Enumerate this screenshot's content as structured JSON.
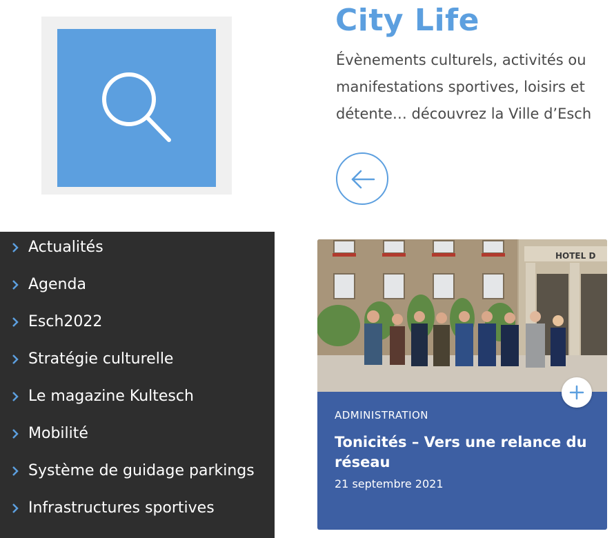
{
  "search_tile": {
    "icon": "search-icon",
    "color": "#5c9fdf"
  },
  "city_life": {
    "title": "City Life",
    "description": "Évènements culturels, activités ou manifestations sportives, loisirs et détente… découvrez la Ville d’Esch",
    "back_icon": "arrow-left-icon"
  },
  "menu": {
    "items": [
      {
        "label": "Actualités"
      },
      {
        "label": "Agenda"
      },
      {
        "label": "Esch2022"
      },
      {
        "label": "Stratégie culturelle"
      },
      {
        "label": "Le magazine Kultesch"
      },
      {
        "label": "Mobilité"
      },
      {
        "label": "Système de guidage parkings"
      },
      {
        "label": "Infrastructures sportives"
      }
    ]
  },
  "news_card": {
    "photo_sign": "HOTEL D",
    "category": "ADMINISTRATION",
    "title": "Tonicités – Vers une relance du réseau",
    "date": "21 septembre 2021",
    "plus_icon": "plus-icon"
  },
  "colors": {
    "accent": "#5c9fdf",
    "menu_bg": "#2e2e2e",
    "card_bg": "#3d5fa3"
  }
}
